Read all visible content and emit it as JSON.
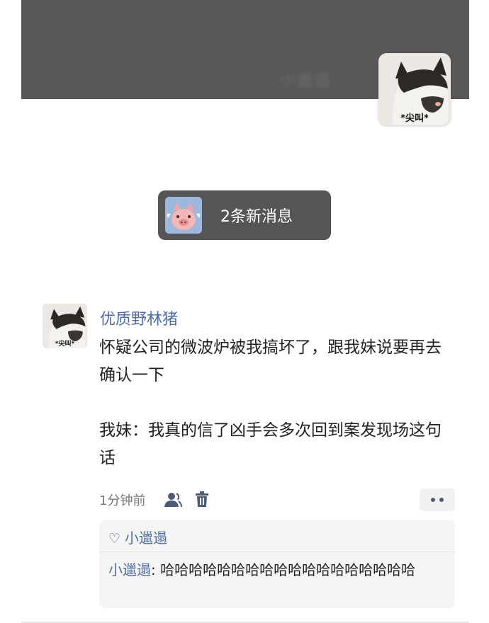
{
  "cover": {
    "blurred_text": "小邋遢",
    "avatar_caption": "*尖叫*"
  },
  "notification": {
    "text": "2条新消息"
  },
  "comment": {
    "avatar_caption": "*尖叫*",
    "username": "优质野林猪",
    "message_lines": [
      "怀疑公司的微波炉被我搞坏了，跟我妹说要再去确认一下",
      "我妹：我真的信了凶手会多次回到案发现场这句话"
    ],
    "time": "1分钟前"
  },
  "likes": {
    "users": "小邋遢"
  },
  "reply": {
    "author": "小邋遢",
    "separator": ": ",
    "text": "哈哈哈哈哈哈哈哈哈哈哈哈哈哈哈哈哈哈"
  },
  "colors": {
    "accent": "#4e6ea3",
    "cover_bg": "#585858",
    "pill_bg": "#555555"
  },
  "icons": [
    "user-icon",
    "trash-icon",
    "more-icon",
    "heart-icon"
  ]
}
